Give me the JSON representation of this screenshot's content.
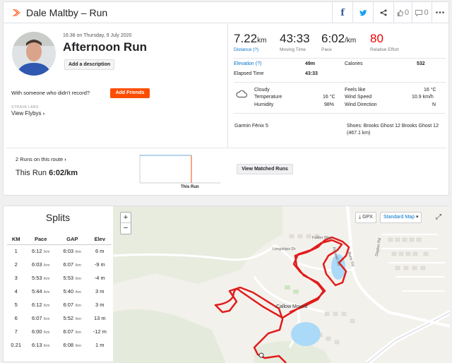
{
  "header": {
    "title": "Dale Maltby – Run",
    "kudos_count": "0",
    "comment_count": "0"
  },
  "activity": {
    "date": "16:38 on Thursday, 9 July 2020",
    "title": "Afternoon Run",
    "add_description": "Add a description",
    "with_someone": "With someone who didn't record?",
    "add_friends": "Add Friends",
    "labs": "STRAVA LABS",
    "flybys": "View Flybys"
  },
  "stats": {
    "distance": {
      "value": "7.22",
      "unit": "km",
      "label": "Distance (?)"
    },
    "moving_time": {
      "value": "43:33",
      "label": "Moving Time"
    },
    "pace": {
      "value": "6:02",
      "unit": "/km",
      "label": "Pace"
    },
    "relative_effort": {
      "value": "80",
      "label": "Relative Effort"
    },
    "elevation": {
      "label": "Elevation (?)",
      "value": "49m"
    },
    "elapsed": {
      "label": "Elapsed Time",
      "value": "43:33"
    },
    "calories": {
      "label": "Calories",
      "value": "532"
    }
  },
  "weather": {
    "condition": "Cloudy",
    "temperature_label": "Temperature",
    "temperature": "16 °C",
    "humidity_label": "Humidity",
    "humidity": "98%",
    "feels_like_label": "Feels like",
    "feels_like": "16 °C",
    "wind_speed_label": "Wind Speed",
    "wind_speed": "10.9 km/h",
    "wind_direction_label": "Wind Direction",
    "wind_direction": "N"
  },
  "gear": {
    "device": "Garmin Fēnix 5",
    "shoes": "Shoes: Brooks Ghost 12 Brooks Ghost 12",
    "shoes_distance": "(467.1 km)"
  },
  "route": {
    "runs_on_route": "2 Runs on this route",
    "this_run_label": "This Run",
    "this_run_pace": "6:02/km",
    "view_matched": "View Matched Runs",
    "chart_label": "This Run"
  },
  "splits": {
    "title": "Splits",
    "columns": [
      "KM",
      "Pace",
      "GAP",
      "Elev"
    ],
    "unit": "/km",
    "rows": [
      {
        "km": "1",
        "pace": "6:12",
        "gap": "6:03",
        "elev": "6 m"
      },
      {
        "km": "2",
        "pace": "6:03",
        "gap": "6:07",
        "elev": "-9 m"
      },
      {
        "km": "3",
        "pace": "5:53",
        "gap": "5:53",
        "elev": "-4 m"
      },
      {
        "km": "4",
        "pace": "5:44",
        "gap": "5:40",
        "elev": "3 m"
      },
      {
        "km": "5",
        "pace": "6:12",
        "gap": "6:07",
        "elev": "3 m"
      },
      {
        "km": "6",
        "pace": "6:07",
        "gap": "5:52",
        "elev": "13 m"
      },
      {
        "km": "7",
        "pace": "6:00",
        "gap": "6:07",
        "elev": "-12 m"
      },
      {
        "km": "0.21",
        "pace": "6:13",
        "gap": "6:08",
        "elev": "1 m"
      }
    ]
  },
  "map": {
    "zoom_in": "+",
    "zoom_out": "−",
    "gpx": "GPX",
    "map_type": "Standard Map",
    "labels": {
      "fulton": "Fulton Way",
      "longships": "Longships Dr",
      "dayton": "Dayton Rd",
      "callow": "Callow Mound",
      "ashwell": "Ashwell Rd",
      "bunker": "Bunk Rd"
    },
    "route_color": "#e01c1c"
  },
  "colors": {
    "brand": "#fc4c02",
    "link": "#0073c9",
    "effort": "#e00000"
  }
}
